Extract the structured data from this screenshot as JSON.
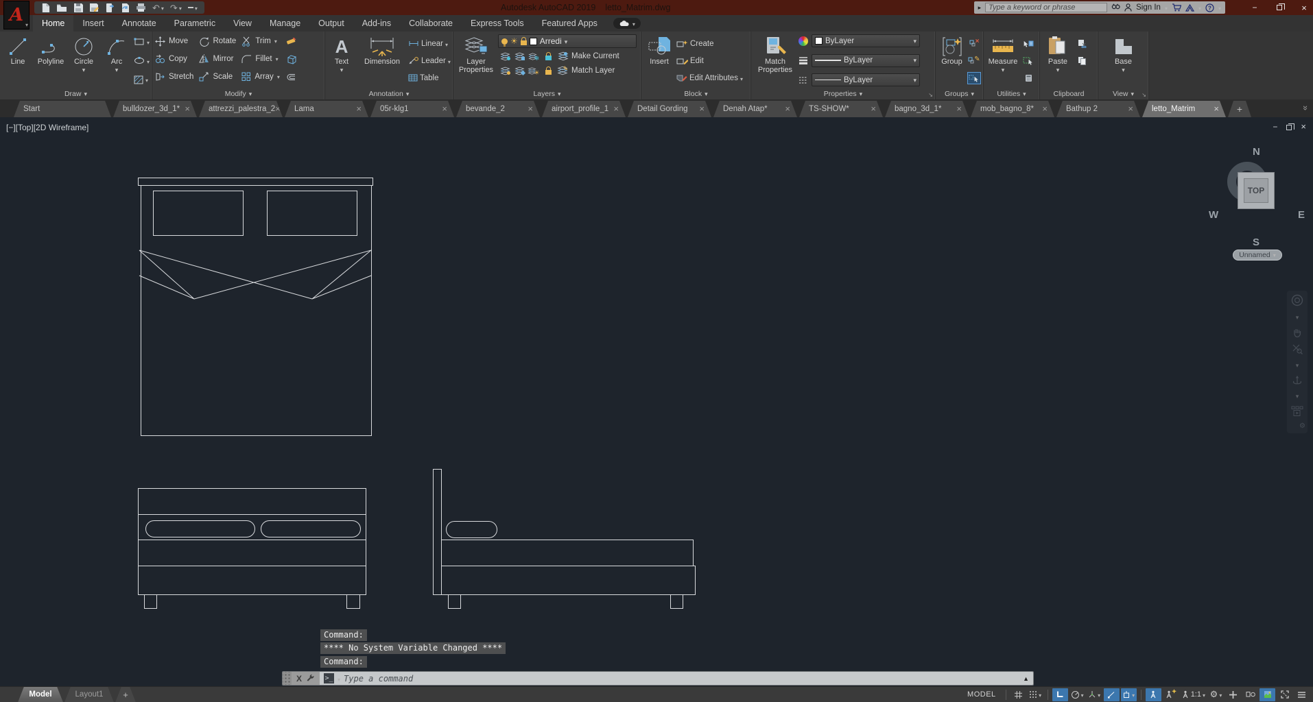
{
  "titlebar": {
    "app_title": "Autodesk AutoCAD 2019",
    "doc_title": "letto_Matrim.dwg",
    "search_placeholder": "Type a keyword or phrase",
    "sign_in_label": "Sign In"
  },
  "ribbon_tabs": [
    "Home",
    "Insert",
    "Annotate",
    "Parametric",
    "View",
    "Manage",
    "Output",
    "Add-ins",
    "Collaborate",
    "Express Tools",
    "Featured Apps"
  ],
  "ribbon": {
    "draw": {
      "label": "Draw",
      "buttons": [
        "Line",
        "Polyline",
        "Circle",
        "Arc"
      ]
    },
    "modify": {
      "label": "Modify",
      "buttons": [
        "Move",
        "Rotate",
        "Trim",
        "Copy",
        "Mirror",
        "Fillet",
        "Stretch",
        "Scale",
        "Array"
      ]
    },
    "annotation": {
      "label": "Annotation",
      "text": "Text",
      "dimension": "Dimension",
      "linear": "Linear",
      "leader": "Leader",
      "table": "Table"
    },
    "layers": {
      "label": "Layers",
      "layer_properties": "Layer Properties",
      "current_layer": "Arredi",
      "make_current": "Make Current",
      "match_layer": "Match Layer"
    },
    "block": {
      "label": "Block",
      "insert": "Insert",
      "create": "Create",
      "edit": "Edit",
      "edit_attributes": "Edit Attributes"
    },
    "properties": {
      "label": "Properties",
      "match_properties": "Match Properties",
      "color": "ByLayer",
      "lineweight": "ByLayer",
      "linetype": "ByLayer"
    },
    "groups": {
      "label": "Groups",
      "group": "Group"
    },
    "utilities": {
      "label": "Utilities",
      "measure": "Measure"
    },
    "clipboard": {
      "label": "Clipboard",
      "paste": "Paste"
    },
    "view": {
      "label": "View",
      "base": "Base"
    }
  },
  "file_tabs": [
    {
      "label": "Start"
    },
    {
      "label": "bulldozer_3d_1*"
    },
    {
      "label": "attrezzi_palestra_2"
    },
    {
      "label": "Lama"
    },
    {
      "label": "05r-klg1"
    },
    {
      "label": "bevande_2"
    },
    {
      "label": "airport_profile_1"
    },
    {
      "label": "Detail Gording"
    },
    {
      "label": "Denah Atap*"
    },
    {
      "label": "TS-SHOW*"
    },
    {
      "label": "bagno_3d_1*"
    },
    {
      "label": "mob_bagno_8*"
    },
    {
      "label": "Bathup 2"
    },
    {
      "label": "letto_Matrim"
    }
  ],
  "viewport": {
    "corner_label": "[−][Top][2D Wireframe]",
    "viewcube": {
      "north": "N",
      "east": "E",
      "south": "S",
      "west": "W",
      "face": "TOP",
      "view_name": "Unnamed"
    }
  },
  "command_line": {
    "history": [
      "Command:",
      "**** No System Variable Changed ****",
      "Command:"
    ],
    "input_placeholder": "Type a command"
  },
  "statusbar": {
    "model_tab": "Model",
    "layout_tab": "Layout1",
    "mode": "MODEL",
    "annotation_scale": "1:1"
  },
  "colors": {
    "titlebar": "#4d1a10",
    "ribbon_bg": "#3b3b3b",
    "canvas_bg": "#1e242c",
    "wireframe": "#d9dbde",
    "accent_blue": "#6fb3e0",
    "accent_yellow": "#e9b64e",
    "status_active_blue": "#3c77ae",
    "current_layer_color": "#ffffff"
  }
}
